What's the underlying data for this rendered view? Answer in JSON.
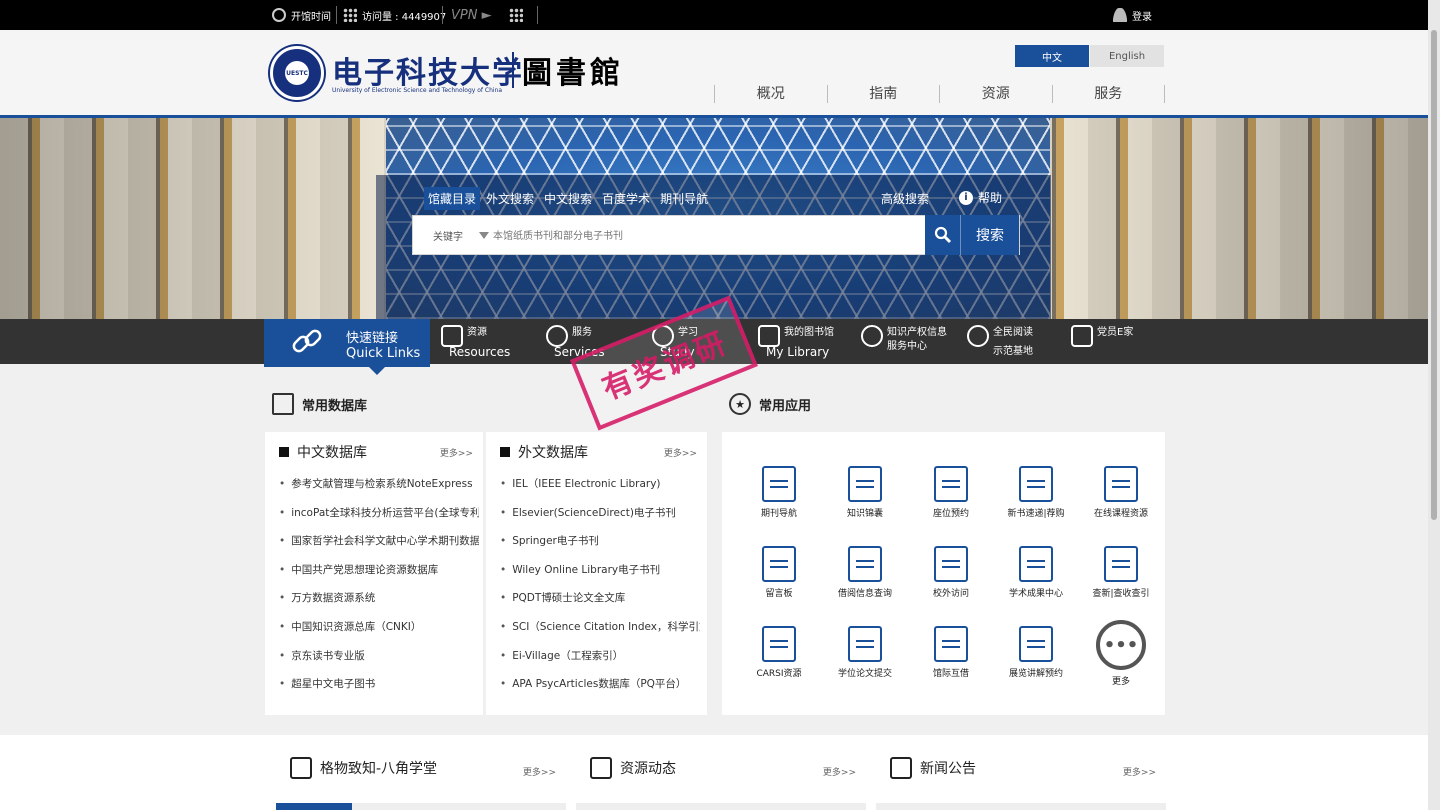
{
  "topbar": {
    "open_hours": "开馆时间",
    "visits": "访问量 : 4449907",
    "vpn": "VPN ►",
    "login": "登录"
  },
  "header": {
    "logo_cn": "电子科技大学",
    "logo_en": "University of Electronic Science and Technology of China",
    "seal_text": "UESTC",
    "library": "圖書館",
    "lang_cn": "中文",
    "lang_en": "English",
    "nav": [
      "概况",
      "指南",
      "资源",
      "服务"
    ]
  },
  "search": {
    "tabs": [
      "馆藏目录",
      "外文搜索",
      "中文搜索",
      "百度学术",
      "期刊导航"
    ],
    "advanced": "高级搜索",
    "help": "帮助",
    "field": "关键字",
    "placeholder": "本馆纸质书刊和部分电子书刊",
    "button": "搜索"
  },
  "quicklinks": {
    "title_cn": "快速链接",
    "title_en": "Quick Links",
    "items": [
      {
        "cn": "资源",
        "en": "Resources"
      },
      {
        "cn": "服务",
        "en": "Services"
      },
      {
        "cn": "学习",
        "en": "Study"
      },
      {
        "cn": "我的图书馆",
        "en": "My Library"
      },
      {
        "cn": "知识产权信息",
        "en": "服务中心"
      },
      {
        "cn": "全民阅读",
        "en": "示范基地"
      },
      {
        "cn": "党员E家",
        "en": ""
      }
    ],
    "stamp": "有奖调研"
  },
  "databases": {
    "title": "常用数据库",
    "cn": {
      "title": "中文数据库",
      "more": "更多>>",
      "items": [
        "参考文献管理与检索系统NoteExpress",
        "incoPat全球科技分析运营平台(全球专利",
        "国家哲学社会科学文献中心学术期刊数据",
        "中国共产党思想理论资源数据库",
        "万方数据资源系统",
        "中国知识资源总库（CNKI）",
        "京东读书专业版",
        "超星中文电子图书"
      ]
    },
    "en": {
      "title": "外文数据库",
      "more": "更多>>",
      "items": [
        "IEL（IEEE Electronic Library)",
        "Elsevier(ScienceDirect)电子书刊",
        "Springer电子书刊",
        "Wiley Online Library电子书刊",
        "PQDT博硕士论文全文库",
        "SCI（Science Citation Index，科学引文",
        "Ei-Village（工程索引）",
        "APA PsycArticles数据库（PQ平台）"
      ]
    }
  },
  "apps": {
    "title": "常用应用",
    "items": [
      "期刊导航",
      "知识锦囊",
      "座位预约",
      "新书速递|荐购",
      "在线课程资源",
      "留言板",
      "借阅信息查询",
      "校外访问",
      "学术成果中心",
      "查新|查收查引",
      "CARSI资源",
      "学位论文提交",
      "馆际互借",
      "展览讲解预约",
      "更多"
    ],
    "more_glyph": "•••"
  },
  "bottom": [
    {
      "title": "格物致知-八角学堂",
      "more": "更多>>"
    },
    {
      "title": "资源动态",
      "more": "更多>>"
    },
    {
      "title": "新闻公告",
      "more": "更多>>"
    }
  ]
}
